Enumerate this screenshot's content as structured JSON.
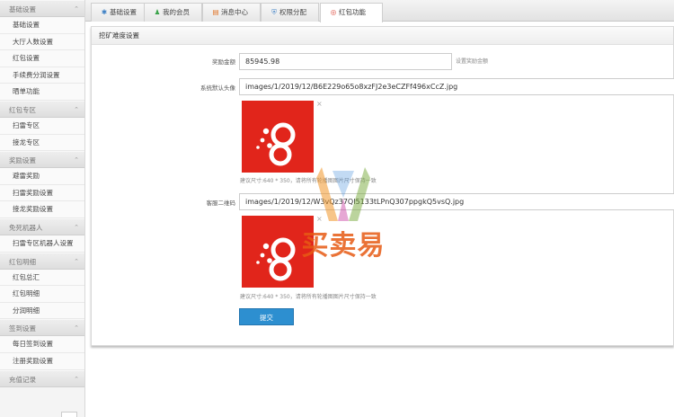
{
  "sidebar": {
    "groups": [
      {
        "title": "基础设置",
        "items": [
          "基础设置",
          "大厅人数设置",
          "红包设置",
          "手续费分润设置",
          "晒单功能"
        ]
      },
      {
        "title": "红包专区",
        "items": [
          "扫雷专区",
          "接龙专区"
        ]
      },
      {
        "title": "奖励设置",
        "items": [
          "避雷奖励",
          "扫雷奖励设置",
          "接龙奖励设置"
        ]
      },
      {
        "title": "免死机器人",
        "items": [
          "扫雷专区机器人设置"
        ]
      },
      {
        "title": "红包明细",
        "items": [
          "红包总汇",
          "红包明细",
          "分润明细"
        ]
      },
      {
        "title": "签到设置",
        "items": [
          "每日签到设置",
          "注册奖励设置"
        ]
      },
      {
        "title": "充值记录",
        "items": []
      }
    ]
  },
  "tabs": [
    {
      "label": "基础设置",
      "icon": "gear-icon",
      "glyph": "✱"
    },
    {
      "label": "我的会员",
      "icon": "user-icon",
      "glyph": "♟"
    },
    {
      "label": "消息中心",
      "icon": "message-icon",
      "glyph": "▤"
    },
    {
      "label": "权限分配",
      "icon": "shield-icon",
      "glyph": "⛨"
    },
    {
      "label": "红包功能",
      "icon": "redpacket-icon",
      "glyph": "◎"
    }
  ],
  "panel": {
    "title": "挖矿难度设置",
    "reward_amount": {
      "label": "奖励金额",
      "value": "85945.98",
      "hint": "设置奖励金额"
    },
    "default_avatar": {
      "label": "系统默认头像",
      "value": "images/1/2019/12/B6E229o65o8xzFJ2e3eCZFf496xCcZ.jpg",
      "hint": "建议尺寸:640 * 350，请将所有轮播图图片尺寸保持一致"
    },
    "qr_code": {
      "label": "客服二维码",
      "value": "images/1/2019/12/W3vQz37QI5133tLPnQ307ppgkQ5vsQ.jpg",
      "hint": "建议尺寸:640 * 350，请将所有轮播图图片尺寸保持一致"
    },
    "remove_glyph": "×",
    "submit_label": "提交"
  },
  "watermark": {
    "text": "买卖易"
  },
  "colors": {
    "accent": "#2d8fd0",
    "image_bg": "#e1251b"
  }
}
